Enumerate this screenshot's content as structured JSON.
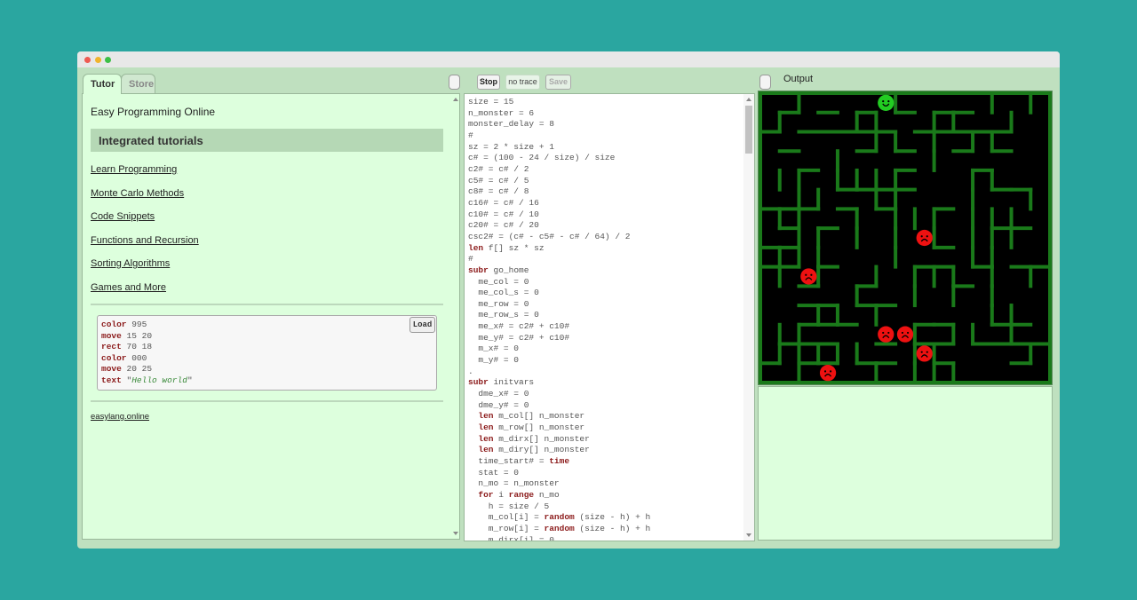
{
  "tabs": {
    "tutor": "Tutor",
    "store": "Store"
  },
  "tutor": {
    "title": "Easy Programming Online",
    "header": "Integrated tutorials",
    "links": [
      "Learn Programming",
      "Monte Carlo Methods",
      "Code Snippets",
      "Functions and Recursion",
      "Sorting Algorithms",
      "Games and More"
    ],
    "example": {
      "load_label": "Load",
      "lines": [
        {
          "kw": "color",
          "arg": "995"
        },
        {
          "kw": "move",
          "arg": "15 20"
        },
        {
          "kw": "rect",
          "arg": "70 18"
        },
        {
          "kw": "color",
          "arg": "000"
        },
        {
          "kw": "move",
          "arg": "20 25"
        },
        {
          "kw": "text",
          "arg": "Hello world"
        }
      ]
    },
    "footer": "easylang.online"
  },
  "toolbar": {
    "stop": "Stop",
    "no_trace": "no trace",
    "save": "Save"
  },
  "output": {
    "label": "Output"
  },
  "editor": {
    "lines": [
      "size = 15",
      "n_monster = 6",
      "monster_delay = 8",
      "#",
      "sz = 2 * size + 1",
      "c# = (100 - 24 / size) / size",
      "c2# = c# / 2",
      "c5# = c# / 5",
      "c8# = c# / 8",
      "c16# = c# / 16",
      "c10# = c# / 10",
      "c20# = c# / 20",
      "csc2# = (c# - c5# - c# / 64) / 2",
      "**len** f[] sz * sz",
      "#",
      "**subr** go_home",
      "  me_col = 0",
      "  me_col_s = 0",
      "  me_row = 0",
      "  me_row_s = 0",
      "  me_x# = c2# + c10#",
      "  me_y# = c2# + c10#",
      "  m_x# = 0",
      "  m_y# = 0",
      ".",
      "**subr** initvars",
      "  dme_x# = 0",
      "  dme_y# = 0",
      "  **len** m_col[] n_monster",
      "  **len** m_row[] n_monster",
      "  **len** m_dirx[] n_monster",
      "  **len** m_diry[] n_monster",
      "  time_start# = **time**",
      "  stat = 0",
      "  n_mo = n_monster",
      "  **for** i **range** n_mo",
      "    h = size / 5",
      "    m_col[i] = **random** (size - h) + h",
      "    m_row[i] = **random** (size - h) + h",
      "    m_dirx[i] = 0"
    ]
  },
  "game": {
    "colors": {
      "wall": "#1a7a1a",
      "background": "#000000",
      "player": "#22cc22",
      "monster": "#ee1111"
    },
    "grid_size": 15,
    "player": {
      "col": 6,
      "row": 0
    },
    "monsters": [
      {
        "col": 8,
        "row": 7
      },
      {
        "col": 2,
        "row": 9
      },
      {
        "col": 6,
        "row": 12
      },
      {
        "col": 7,
        "row": 12
      },
      {
        "col": 8,
        "row": 13
      },
      {
        "col": 3,
        "row": 14
      }
    ]
  }
}
